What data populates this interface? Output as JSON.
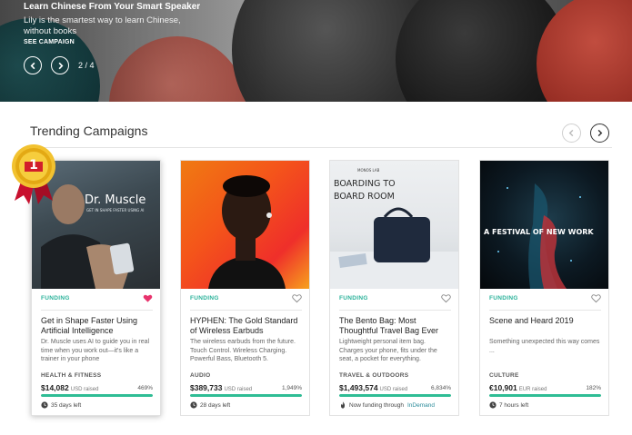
{
  "hero": {
    "title": "Learn Chinese From Your Smart Speaker",
    "description": "Lily is the smartest way to learn Chinese, without books",
    "cta": "SEE CAMPAIGN",
    "counter": "2 / 4"
  },
  "trending": {
    "title": "Trending Campaigns",
    "cards": [
      {
        "tag": "FUNDING",
        "liked": true,
        "image_text": [
          "Dr. Muscle",
          "GET IN SHAPE FASTER USING AI"
        ],
        "title": "Get in Shape Faster Using Artificial Intelligence",
        "description": "Dr. Muscle uses AI to guide you in real time when you work out—it's like a trainer in your phone",
        "category": "HEALTH & FITNESS",
        "amount": "$14,082",
        "unit": "USD raised",
        "percent": "469%",
        "progress": 1.0,
        "meta": "35 days left"
      },
      {
        "tag": "FUNDING",
        "liked": false,
        "title": "HYPHEN: The Gold Standard of Wireless Earbuds",
        "description": "The wireless earbuds from the future. Touch Control. Wireless Charging. Powerful Bass, Bluetooth 5.",
        "category": "AUDIO",
        "amount": "$389,733",
        "unit": "USD raised",
        "percent": "1,949%",
        "progress": 1.0,
        "meta": "28 days left"
      },
      {
        "tag": "FUNDING",
        "liked": false,
        "image_text": [
          "MONOS LAB",
          "BOARDING TO",
          "BOARD ROOM"
        ],
        "title": "The Bento Bag: Most Thoughtful Travel Bag Ever",
        "description": "Lightweight personal item bag. Charges your phone, fits under the seat, a pocket for everything.",
        "category": "TRAVEL & OUTDOORS",
        "amount": "$1,493,574",
        "unit": "USD raised",
        "percent": "6,834%",
        "progress": 1.0,
        "meta": "Now funding through",
        "meta_link": "InDemand"
      },
      {
        "tag": "FUNDING",
        "liked": false,
        "image_text": [
          "A FESTIVAL OF NEW WORK"
        ],
        "title": "Scene and Heard 2019",
        "description": "Something unexpected this way comes ...",
        "category": "CULTURE",
        "amount": "€10,901",
        "unit": "EUR raised",
        "percent": "182%",
        "progress": 1.0,
        "meta": "7 hours left"
      }
    ]
  },
  "badge": {
    "rank": "1"
  },
  "colors": {
    "accent": "#2fbd95",
    "tag": "#2ab29a",
    "liked_heart": "#e8336d"
  }
}
